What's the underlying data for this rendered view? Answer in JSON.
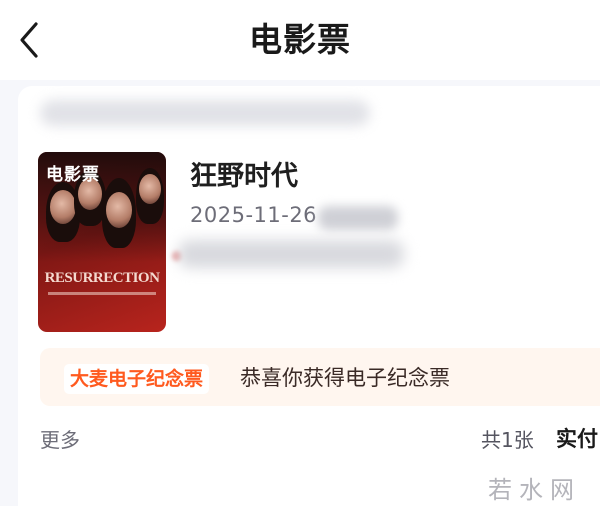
{
  "header": {
    "title": "电影票",
    "back_icon": "chevron-left-icon"
  },
  "ticket": {
    "poster": {
      "badge": "电影票",
      "title_text": "RESURRECTION"
    },
    "movie_name": "狂野时代",
    "show_date": "2025-11-26"
  },
  "souvenir_banner": {
    "tag": "大麦电子纪念票",
    "message": "恭喜你获得电子纪念票",
    "accent_color": "#ff5a1f"
  },
  "footer": {
    "more_label": "更多",
    "count_label": "共1张",
    "paid_label": "实付"
  },
  "watermark": "若水网"
}
